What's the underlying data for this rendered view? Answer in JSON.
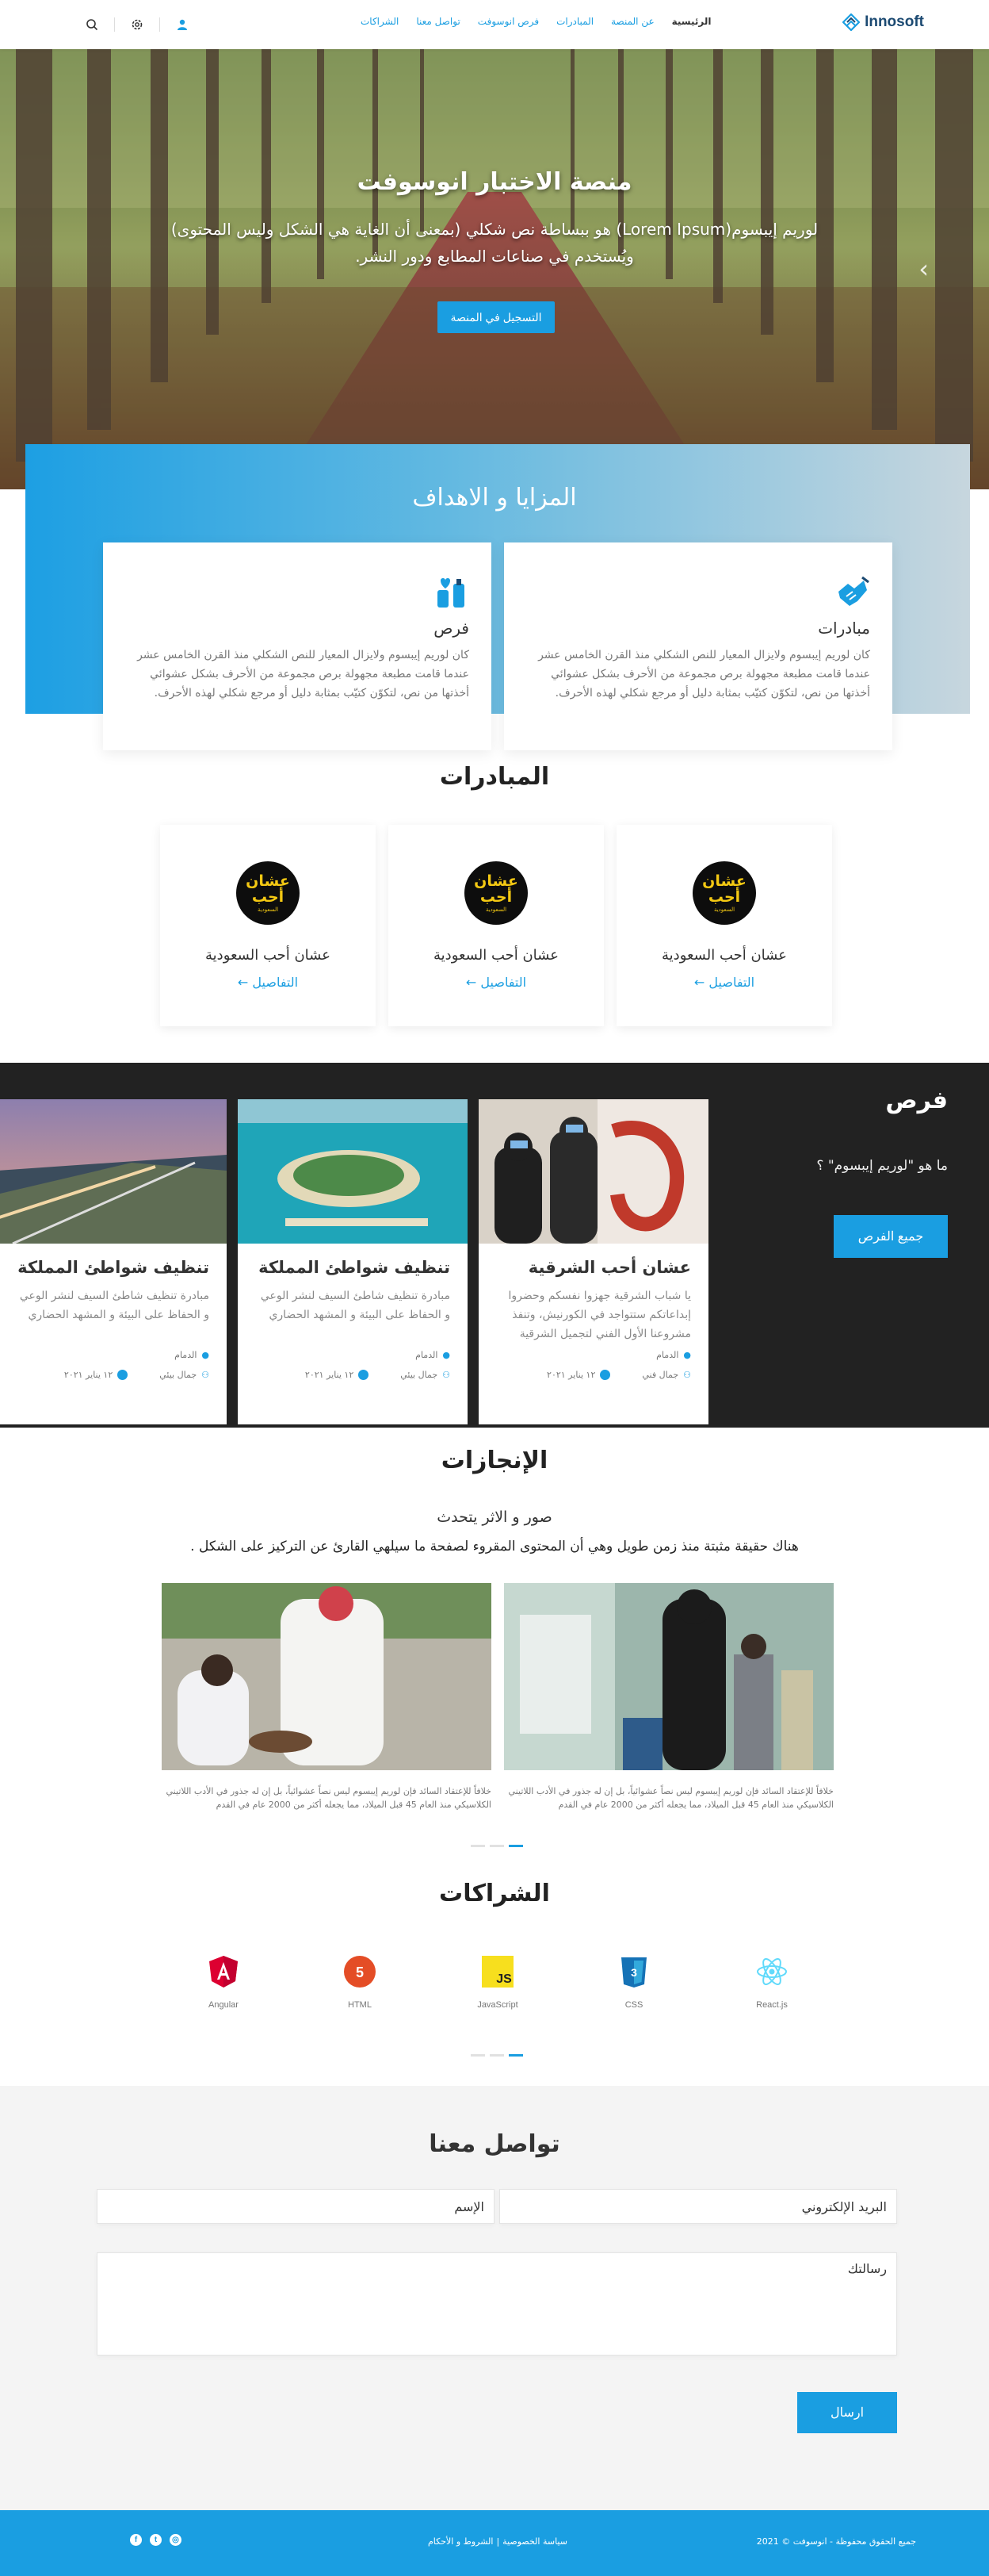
{
  "header": {
    "logo_text": "Innosoft",
    "nav": [
      "الرئيسية",
      "عن المنصة",
      "المبادرات",
      "فرص انوسوفت",
      "تواصل معنا",
      "الشراكات"
    ]
  },
  "hero": {
    "title": "منصة الاختبار انوسوفت",
    "description": "لوريم إيبسوم(Lorem Ipsum) هو ببساطة نص شكلي (بمعنى أن الغاية هي الشكل وليس المحتوى) ويُستخدم في صناعات المطابع ودور النشر.",
    "cta": "التسجيل في المنصة"
  },
  "features": {
    "title": "المزايا و الاهداف",
    "items": [
      {
        "title": "مبادرات",
        "text": "كان لوريم إيبسوم ولايزال المعيار للنص الشكلي منذ القرن الخامس عشر عندما قامت مطبعة مجهولة برص مجموعة من الأحرف بشكل عشوائي أخذتها من نص، لتكوّن كتيّب بمثابة دليل أو مرجع شكلي لهذه الأحرف."
      },
      {
        "title": "فرص",
        "text": "كان لوريم إيبسوم ولايزال المعيار للنص الشكلي منذ القرن الخامس عشر عندما قامت مطبعة مجهولة برص مجموعة من الأحرف بشكل عشوائي أخذتها من نص، لتكوّن كتيّب بمثابة دليل أو مرجع شكلي لهذه الأحرف."
      }
    ]
  },
  "initiatives": {
    "title": "المبادرات",
    "logo_line1": "عشان أحب",
    "logo_line2": "السعودية",
    "items": [
      {
        "name": "عشان أحب السعودية",
        "link": "التفاصيل"
      },
      {
        "name": "عشان أحب السعودية",
        "link": "التفاصيل"
      },
      {
        "name": "عشان أحب السعودية",
        "link": "التفاصيل"
      }
    ]
  },
  "opportunities": {
    "title": "فرص",
    "subtitle": "ما هو \"لوريم إيبسوم\" ؟",
    "button": "جميع الفرص",
    "cards": [
      {
        "title": "عشان أحب الشرقية",
        "text": "يا شباب الشرقية جهزوا نفسكم وحضروا إبداعاتكم ستتواجد في الكورنيش، وتنفذ مشروعنا الأول الفني لتجميل الشرقية",
        "location": "الدمام",
        "org": "جمال فني",
        "date": "١٢ يناير ٢٠٢١"
      },
      {
        "title": "تنظيف شواطئ المملكة",
        "text": "مبادرة تنظيف شاطئ السيف لنشر الوعي و الحفاظ على البيئة و المشهد الحضاري",
        "location": "الدمام",
        "org": "جمال بيئي",
        "date": "١٢ يناير ٢٠٢١"
      },
      {
        "title": "تنظيف شواطئ المملكة",
        "text": "مبادرة تنظيف شاطئ السيف لنشر الوعي و الحفاظ على البيئة و المشهد الحضاري",
        "location": "الدمام",
        "org": "جمال بيئي",
        "date": "١٢ يناير ٢٠٢١"
      }
    ]
  },
  "achievements": {
    "title": "الإنجازات",
    "subtitle": "صور و الاثر يتحدث",
    "description": "هناك حقيقة مثبتة منذ زمن طويل وهي أن المحتوى المقروء لصفحة ما سيلهي القارئ عن التركيز على الشكل .",
    "captions": [
      "خلافاً للإعتقاد السائد فإن لوريم إيبسوم ليس نصاً عشوائياً، بل إن له جذور في الأدب اللاتيني الكلاسيكي منذ العام 45 قبل الميلاد، مما يجعله أكثر من 2000 عام في القدم",
      "خلافاً للإعتقاد السائد فإن لوريم إيبسوم ليس نصاً عشوائياً، بل إن له جذور في الأدب اللاتيني الكلاسيكي منذ العام 45 قبل الميلاد، مما يجعله أكثر من 2000 عام في القدم"
    ]
  },
  "partners": {
    "title": "الشراكات",
    "items": [
      "React.js",
      "CSS",
      "JavaScript",
      "HTML",
      "Angular"
    ]
  },
  "contact": {
    "title": "تواصل معنا",
    "email_placeholder": "البريد الإلكتروني",
    "name_placeholder": "الإسم",
    "message_placeholder": "رسالتك",
    "send": "ارسال"
  },
  "footer": {
    "copyright": "جميع الحقوق محفوظة - انوسوفت © 2021",
    "privacy": "سياسة الخصوصية",
    "sep": "|",
    "terms": "الشروط و الأحكام",
    "social": [
      "facebook-icon",
      "twitter-icon",
      "instagram-icon"
    ]
  },
  "colors": {
    "accent": "#1a9ee1",
    "dark_section": "#222222",
    "brand": "#1c4a72"
  }
}
